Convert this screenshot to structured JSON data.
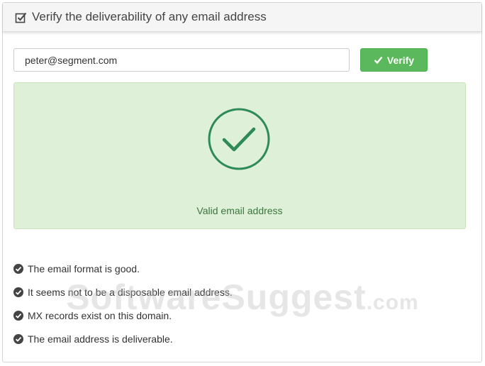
{
  "header": {
    "title": "Verify the deliverability of any email address",
    "icon": "checkbox-icon"
  },
  "form": {
    "email_value": "peter@segment.com",
    "verify_label": "Verify",
    "verify_icon": "check-icon"
  },
  "result": {
    "status_icon": "check-circle-icon",
    "message": "Valid email address",
    "color": "#3c763d",
    "background": "#dff0d8"
  },
  "checks": [
    {
      "icon": "check-circle-icon",
      "text": "The email format is good."
    },
    {
      "icon": "check-circle-icon",
      "text": "It seems not to be a disposable email address."
    },
    {
      "icon": "check-circle-icon",
      "text": "MX records exist on this domain."
    },
    {
      "icon": "check-circle-icon",
      "text": "The email address is deliverable."
    }
  ],
  "watermark": {
    "main": "SoftwareSuggest",
    "suffix": ".com"
  },
  "colors": {
    "accent": "#5cb85c",
    "success_text": "#3c763d",
    "circle": "#2e8b57"
  }
}
